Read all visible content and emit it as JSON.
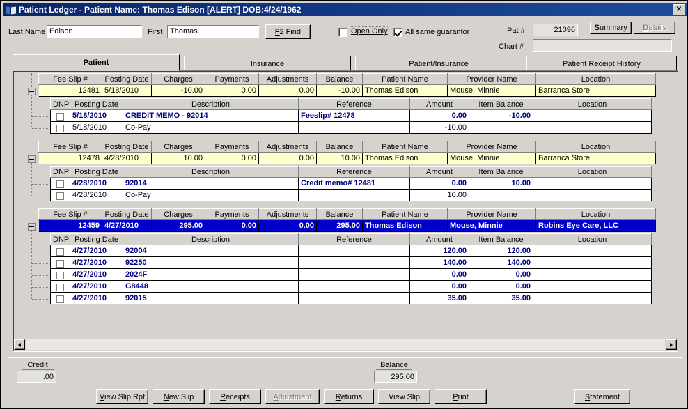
{
  "window": {
    "title": "Patient Ledger - Patient Name: Thomas Edison [ALERT] DOB:4/24/1962",
    "close_label": "✕",
    "icon": "book-icon"
  },
  "form": {
    "last_name_label": "Last Name",
    "last_name_value": "Edison",
    "first_label": "First",
    "first_value": "Thomas",
    "find_button": "F2 Find",
    "find_button_accel": "F",
    "open_only_label": "Open Only",
    "open_only_checked": false,
    "all_same_guarantor_label": "All same guarantor",
    "all_same_guarantor_checked": true,
    "pat_num_label": "Pat #",
    "pat_num_value": "21096",
    "chart_num_label": "Chart #",
    "chart_num_value": "",
    "summary_button": "Summary",
    "details_button": "Details",
    "details_disabled": true
  },
  "tabs": [
    {
      "label": "Patient",
      "active": true
    },
    {
      "label": "Insurance",
      "active": false
    },
    {
      "label": "Patient/Insurance",
      "active": false
    },
    {
      "label": "Patient Receipt History",
      "active": false
    }
  ],
  "master_columns": [
    "Fee Slip #",
    "Posting Date",
    "Charges",
    "Payments",
    "Adjustments",
    "Balance",
    "Patient Name",
    "Provider Name",
    "Location"
  ],
  "detail_columns": [
    "DNP",
    "Posting Date",
    "Description",
    "Reference",
    "Amount",
    "Item Balance",
    "Location"
  ],
  "groups": [
    {
      "selected": false,
      "master": {
        "fee_slip": "12481",
        "posting_date": "5/18/2010",
        "charges": "-10.00",
        "payments": "0.00",
        "adjustments": "0.00",
        "balance": "-10.00",
        "patient_name": "Thomas Edison",
        "provider_name": "Mouse, Minnie",
        "location": "Barranca Store"
      },
      "details": [
        {
          "highlight": true,
          "dnp": false,
          "posting_date": "5/18/2010",
          "description": "CREDIT MEMO - 92014",
          "reference": "Feeslip# 12478",
          "amount": "0.00",
          "item_balance": "-10.00",
          "location": ""
        },
        {
          "highlight": false,
          "dnp": false,
          "posting_date": "5/18/2010",
          "description": "Co-Pay",
          "reference": "",
          "amount": "-10.00",
          "item_balance": "",
          "location": ""
        }
      ]
    },
    {
      "selected": false,
      "master": {
        "fee_slip": "12478",
        "posting_date": "4/28/2010",
        "charges": "10.00",
        "payments": "0.00",
        "adjustments": "0.00",
        "balance": "10.00",
        "patient_name": "Thomas Edison",
        "provider_name": "Mouse, Minnie",
        "location": "Barranca Store"
      },
      "details": [
        {
          "highlight": true,
          "dnp": false,
          "posting_date": "4/28/2010",
          "description": "92014",
          "reference": "Credit memo# 12481",
          "amount": "0.00",
          "item_balance": "10.00",
          "location": ""
        },
        {
          "highlight": false,
          "dnp": false,
          "posting_date": "4/28/2010",
          "description": "Co-Pay",
          "reference": "",
          "amount": "10.00",
          "item_balance": "",
          "location": ""
        }
      ]
    },
    {
      "selected": true,
      "master": {
        "fee_slip": "12459",
        "posting_date": "4/27/2010",
        "charges": "295.00",
        "payments": "0.00",
        "adjustments": "0.00",
        "balance": "295.00",
        "patient_name": "Thomas Edison",
        "provider_name": "Mouse, Minnie",
        "location": "Robins Eye Care, LLC"
      },
      "details": [
        {
          "highlight": true,
          "dnp": false,
          "posting_date": "4/27/2010",
          "description": "92004",
          "reference": "",
          "amount": "120.00",
          "item_balance": "120.00",
          "location": ""
        },
        {
          "highlight": true,
          "dnp": false,
          "posting_date": "4/27/2010",
          "description": "92250",
          "reference": "",
          "amount": "140.00",
          "item_balance": "140.00",
          "location": ""
        },
        {
          "highlight": true,
          "dnp": false,
          "posting_date": "4/27/2010",
          "description": "2024F",
          "reference": "",
          "amount": "0.00",
          "item_balance": "0.00",
          "location": ""
        },
        {
          "highlight": true,
          "dnp": false,
          "posting_date": "4/27/2010",
          "description": "G8448",
          "reference": "",
          "amount": "0.00",
          "item_balance": "0.00",
          "location": ""
        },
        {
          "highlight": true,
          "dnp": false,
          "posting_date": "4/27/2010",
          "description": "92015",
          "reference": "",
          "amount": "35.00",
          "item_balance": "35.00",
          "location": ""
        }
      ]
    }
  ],
  "totals": {
    "credit_label": "Credit",
    "credit_value": ".00",
    "balance_label": "Balance",
    "balance_value": "295.00"
  },
  "buttons": [
    {
      "label": "View Slip Rpt",
      "accel": "V",
      "disabled": false,
      "name": "view-slip-rpt-button"
    },
    {
      "label": "New Slip",
      "accel": "N",
      "disabled": false,
      "name": "new-slip-button"
    },
    {
      "label": "Receipts",
      "accel": "R",
      "disabled": false,
      "name": "receipts-button"
    },
    {
      "label": "Adjustment",
      "accel": "A",
      "disabled": true,
      "name": "adjustment-button"
    },
    {
      "label": "Returns",
      "accel": "R",
      "disabled": false,
      "name": "returns-button"
    },
    {
      "label": "View Slip",
      "accel": "",
      "disabled": false,
      "name": "view-slip-button"
    },
    {
      "label": "Print",
      "accel": "P",
      "disabled": false,
      "name": "print-button"
    },
    {
      "label": "Statement",
      "accel": "S",
      "disabled": false,
      "name": "statement-button"
    }
  ],
  "colors": {
    "title_bar": "#0a246a",
    "face": "#d6d3ce",
    "master_row": "#ffffcc",
    "selection": "#0000cc",
    "detail_text": "#000080"
  }
}
